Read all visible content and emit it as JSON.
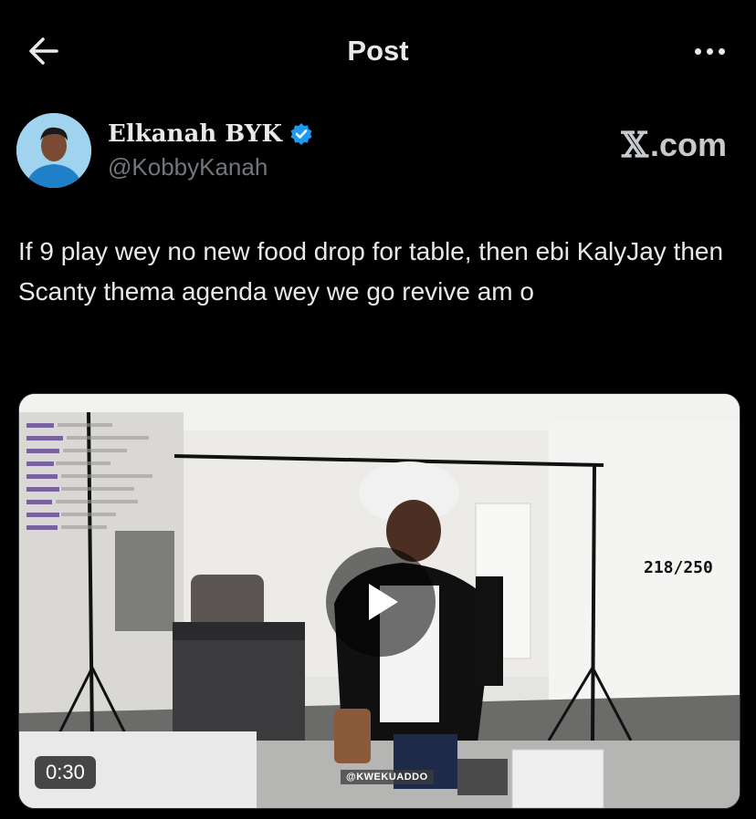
{
  "header": {
    "title": "Post"
  },
  "author": {
    "name": "Elkanah BYK",
    "handle": "@KobbyKanah",
    "verified": true,
    "verified_color": "#1d9bf0"
  },
  "brand": {
    "mark": "𝕏",
    "suffix": ".com"
  },
  "post": {
    "text": "If 9 play wey no new food drop for table, then ebi KalyJay then Scanty thema agenda wey we go revive am o"
  },
  "media": {
    "duration": "0:30",
    "overlay_count": "218/250",
    "watermark": "@KWEKUADDO"
  },
  "icons": {
    "back": "back-arrow-icon",
    "more": "more-options-icon",
    "play": "play-icon"
  }
}
